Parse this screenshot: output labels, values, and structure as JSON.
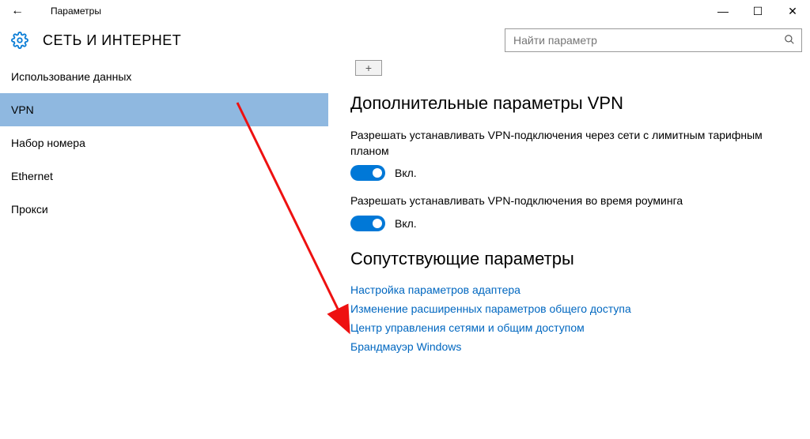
{
  "window": {
    "title": "Параметры",
    "minimize": "—",
    "maximize": "☐",
    "close": "✕"
  },
  "header": {
    "page_title": "СЕТЬ И ИНТЕРНЕТ"
  },
  "search": {
    "placeholder": "Найти параметр"
  },
  "sidebar": {
    "items": [
      {
        "label": "Использование данных",
        "selected": false
      },
      {
        "label": "VPN",
        "selected": true
      },
      {
        "label": "Набор номера",
        "selected": false
      },
      {
        "label": "Ethernet",
        "selected": false
      },
      {
        "label": "Прокси",
        "selected": false
      }
    ]
  },
  "main": {
    "add_glyph": "+",
    "section1_title": "Дополнительные параметры VPN",
    "opt1_label": "Разрешать устанавливать VPN-подключения через сети с лимитным тарифным планом",
    "opt1_state": "Вкл.",
    "opt2_label": "Разрешать устанавливать VPN-подключения во время роуминга",
    "opt2_state": "Вкл.",
    "section2_title": "Сопутствующие параметры",
    "links": [
      "Настройка параметров адаптера",
      "Изменение расширенных параметров общего доступа",
      "Центр управления сетями и общим доступом",
      "Брандмауэр Windows"
    ]
  }
}
